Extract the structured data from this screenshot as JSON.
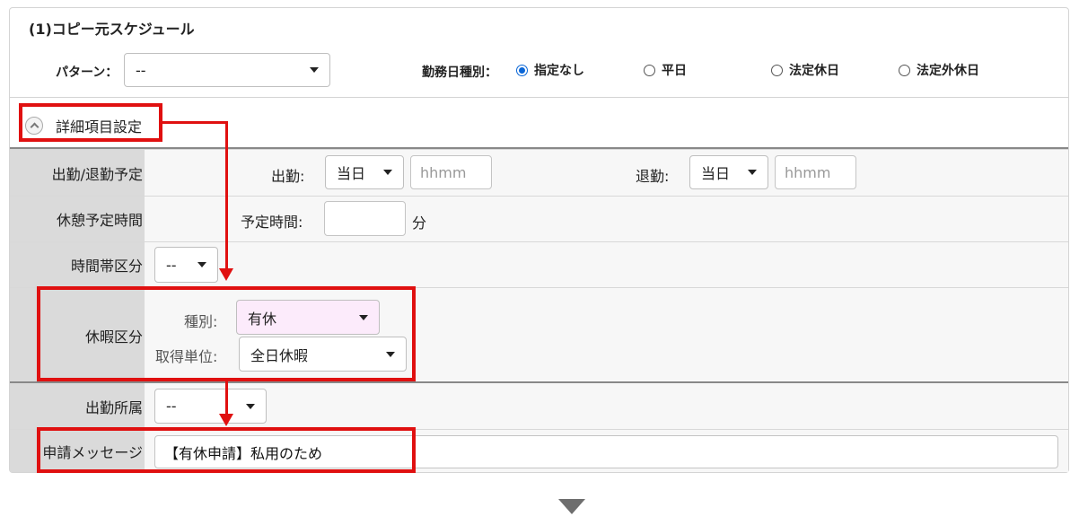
{
  "section": {
    "title": "(1)コピー元スケジュール"
  },
  "pattern": {
    "label": "パターン：",
    "value": "--"
  },
  "workday_type": {
    "label": "勤務日種別：",
    "options": [
      {
        "label": "指定なし",
        "checked": true
      },
      {
        "label": "平日",
        "checked": false
      },
      {
        "label": "法定休日",
        "checked": false
      },
      {
        "label": "法定外休日",
        "checked": false
      }
    ]
  },
  "detail_toggle": {
    "label": "詳細項目設定"
  },
  "rows": {
    "attendance": {
      "header": "出勤/退勤予定",
      "start_label": "出勤:",
      "start_day": "当日",
      "start_time_placeholder": "hhmm",
      "end_label": "退勤:",
      "end_day": "当日",
      "end_time_placeholder": "hhmm"
    },
    "break": {
      "header": "休憩予定時間",
      "label": "予定時間:",
      "value": "",
      "unit": "分"
    },
    "timeslot": {
      "header": "時間帯区分",
      "value": "--"
    },
    "leave": {
      "header": "休暇区分",
      "type_label": "種別:",
      "type_value": "有休",
      "unit_label": "取得単位:",
      "unit_value": "全日休暇"
    },
    "department": {
      "header": "出勤所属",
      "value": "--"
    },
    "message": {
      "header": "申請メッセージ",
      "value": "【有休申請】私用のため"
    }
  },
  "colors": {
    "highlight": "#e01010",
    "radio_accent": "#0a66d6",
    "leave_type_bg": "#fcebfb"
  }
}
